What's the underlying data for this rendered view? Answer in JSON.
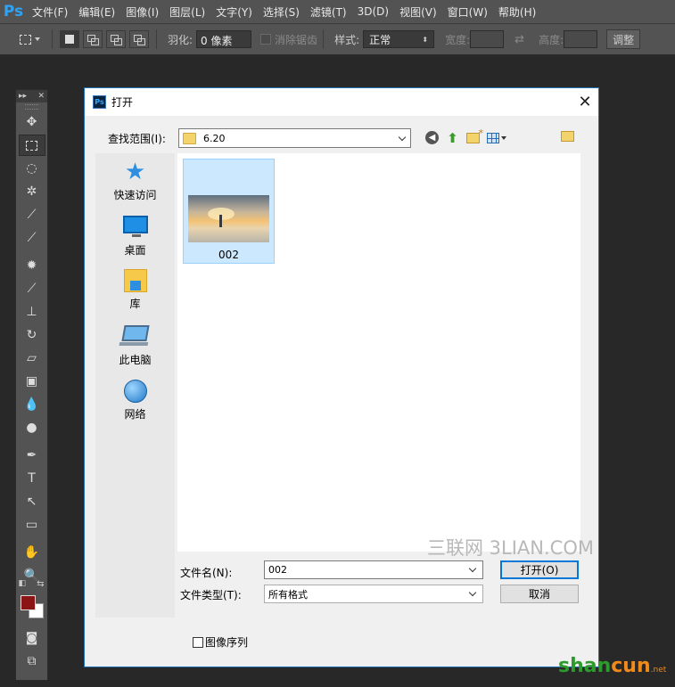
{
  "app": {
    "logo": "Ps"
  },
  "menu": [
    "文件(F)",
    "编辑(E)",
    "图像(I)",
    "图层(L)",
    "文字(Y)",
    "选择(S)",
    "滤镜(T)",
    "3D(D)",
    "视图(V)",
    "窗口(W)",
    "帮助(H)"
  ],
  "options": {
    "feather_label": "羽化:",
    "feather_value": "0 像素",
    "antialias_label": "消除锯齿",
    "style_label": "样式:",
    "style_value": "正常",
    "width_label": "宽度:",
    "height_label": "高度:",
    "adjust_label": "调整"
  },
  "dialog": {
    "title": "打开",
    "look_in_label": "查找范围(I):",
    "look_in_value": "6.20",
    "places": [
      "快速访问",
      "桌面",
      "库",
      "此电脑",
      "网络"
    ],
    "files": [
      {
        "name": "002",
        "selected": true
      }
    ],
    "filename_label": "文件名(N):",
    "filename_value": "002",
    "filetype_label": "文件类型(T):",
    "filetype_value": "所有格式",
    "open_button": "打开(O)",
    "cancel_button": "取消",
    "sequence_label": "图像序列"
  },
  "watermark": "三联网 3LIAN.COM",
  "colors": {
    "foreground": "#8b1414",
    "background": "#ffffff",
    "accent": "#2fa3f7"
  },
  "brand": {
    "logo_a": "shan",
    "logo_b": "cun",
    "logo_c": ".net"
  }
}
